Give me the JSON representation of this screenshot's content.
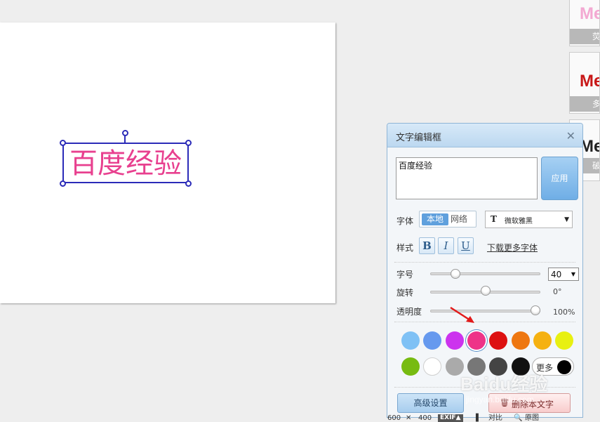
{
  "canvas": {
    "text": "百度经验"
  },
  "style_cards": [
    {
      "preview": "Me",
      "label": "荧",
      "preview_color": "#f3a9d2"
    },
    {
      "preview": "Me",
      "label": "多",
      "preview_color": "#c81818"
    },
    {
      "preview": "Me",
      "label": "破",
      "preview_color": "#222222"
    }
  ],
  "dialog": {
    "title": "文字编辑框",
    "text_value": "百度经验",
    "apply_label": "应用",
    "font_label": "字体",
    "font_local": "本地",
    "font_network": "网络",
    "font_icon": "T",
    "font_name": "微软雅黑",
    "style_label": "样式",
    "bold": "B",
    "italic": "I",
    "underline": "U",
    "download_fonts": "下载更多字体",
    "size_label": "字号",
    "size_value": "40",
    "rotate_label": "旋转",
    "rotate_value": "0°",
    "opacity_label": "透明度",
    "opacity_value": "100%",
    "more_label": "更多",
    "advanced_label": "高级设置",
    "delete_label": "删除本文字",
    "close": "✕"
  },
  "sliders": {
    "size_fraction": 0.2,
    "rotate_fraction": 0.5,
    "opacity_fraction": 1.0
  },
  "swatches": [
    "#7fc1f5",
    "#6699ee",
    "#cc33ee",
    "#ee3388",
    "#dd1111",
    "#ee7711",
    "#f5b111",
    "#e8f011",
    "#77bb11",
    "#ffffff",
    "#aaaaaa",
    "#777777",
    "#444444",
    "#111111"
  ],
  "selected_swatch": 3,
  "status": {
    "width": "600",
    "times": "✕",
    "height": "400",
    "exif": "EXIF▲",
    "contrast": "对比",
    "original": "原图"
  },
  "watermark": {
    "brand": "Baidu经验",
    "url": "jingyan.baidu.com"
  }
}
